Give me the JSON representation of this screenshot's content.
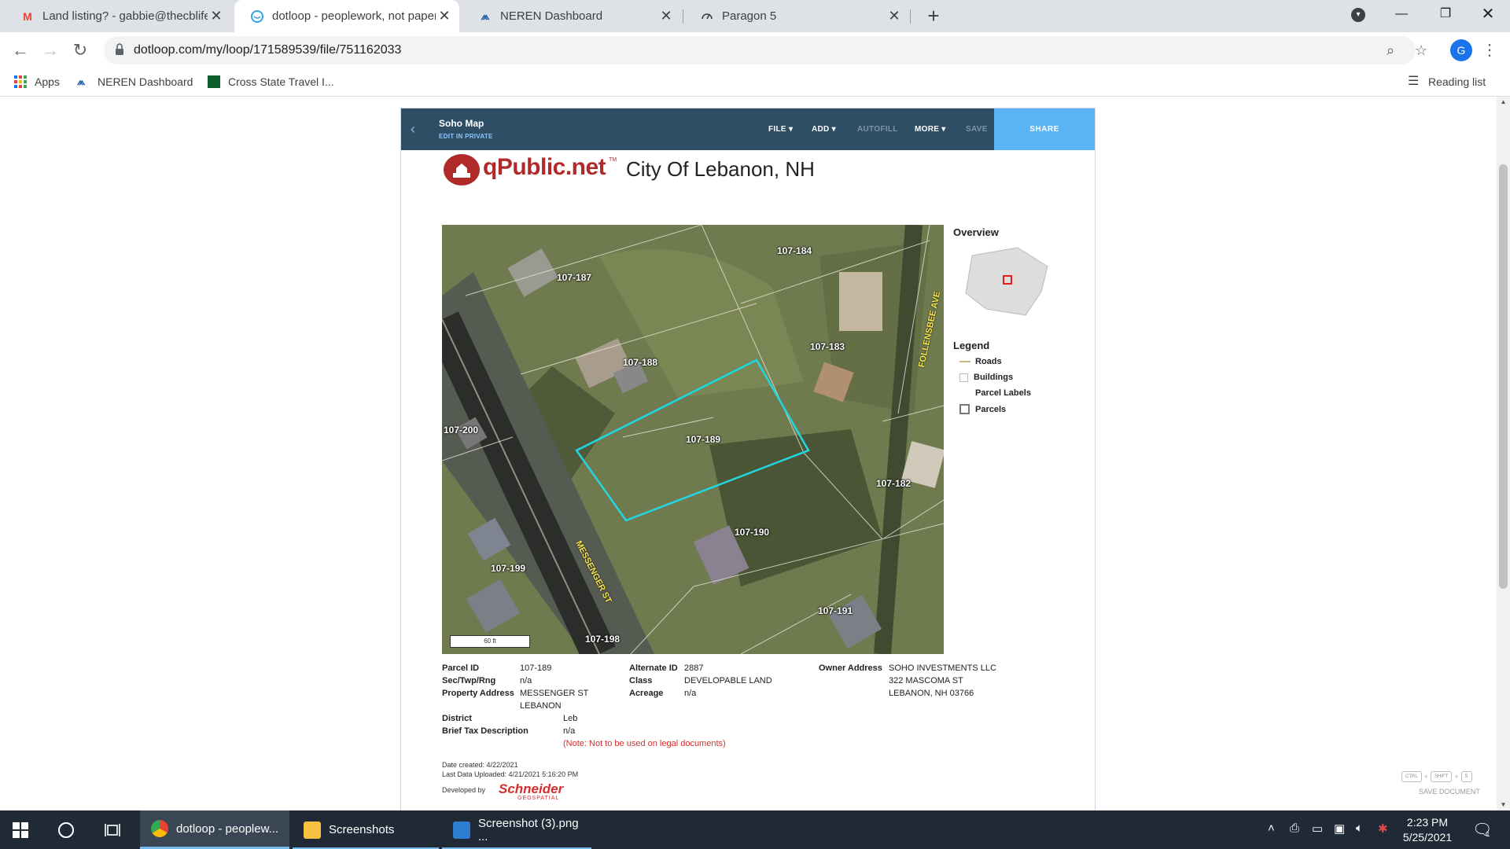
{
  "browser": {
    "tabs": [
      {
        "title": "Land listing? - gabbie@thecblife.",
        "icon": "gmail-icon",
        "active": false
      },
      {
        "title": "dotloop - peoplework, not paper.",
        "icon": "dotloop-icon",
        "active": true
      },
      {
        "title": "NEREN Dashboard",
        "icon": "neren-icon",
        "active": false
      },
      {
        "title": "Paragon 5",
        "icon": "paragon-icon",
        "active": false
      }
    ],
    "url": "dotloop.com/my/loop/171589539/file/751162033",
    "avatar_letter": "G",
    "bookmarks": [
      {
        "label": "Apps"
      },
      {
        "label": "NEREN Dashboard"
      },
      {
        "label": "Cross State Travel I..."
      }
    ],
    "reading_list": "Reading list"
  },
  "dotloop": {
    "doc_name": "Soho Map",
    "edit_mode": "EDIT IN PRIVATE",
    "menu": {
      "file": "FILE",
      "add": "ADD",
      "autofill": "AUTOFILL",
      "more": "MORE",
      "save": "SAVE",
      "share": "SHARE"
    },
    "save_shortcut": {
      "keys": [
        "CTRL",
        "SHIFT",
        "S"
      ],
      "label": "SAVE DOCUMENT"
    }
  },
  "document": {
    "logo_text": "qPublic.net",
    "logo_tm": "TM",
    "city": "City Of Lebanon, NH",
    "map": {
      "parcel_labels": [
        "107-187",
        "107-184",
        "107-183",
        "107-188",
        "107-200",
        "107-189",
        "107-182",
        "107-190",
        "107-199",
        "107-191",
        "107-198"
      ],
      "streets": [
        "MESSENGER ST",
        "FOLLENSBEE AVE"
      ],
      "scale": "60 ft"
    },
    "overview_title": "Overview",
    "legend_title": "Legend",
    "legend_items": [
      "Roads",
      "Buildings",
      "Parcel Labels",
      "Parcels"
    ],
    "fields": {
      "parcel_id_label": "Parcel ID",
      "parcel_id": "107-189",
      "sec_label": "Sec/Twp/Rng",
      "sec": "n/a",
      "address_label": "Property Address",
      "address_1": "MESSENGER ST",
      "address_2": "LEBANON",
      "district_label": "District",
      "district": "Leb",
      "brief_label": "Brief Tax Description",
      "brief": "n/a",
      "note": "(Note: Not to be used on legal documents)",
      "alt_id_label": "Alternate ID",
      "alt_id": "2887",
      "class_label": "Class",
      "class": "DEVELOPABLE LAND",
      "acreage_label": "Acreage",
      "acreage": "n/a",
      "owner_label": "Owner Address",
      "owner_1": "SOHO INVESTMENTS LLC",
      "owner_2": "322 MASCOMA ST",
      "owner_3": "LEBANON, NH 03766"
    },
    "date_created": "Date created: 4/22/2021",
    "last_upload": "Last Data Uploaded: 4/21/2021 5:16:20 PM",
    "developed_by": "Developed by",
    "developer": "Schneider",
    "developer_sub": "GEOSPATIAL"
  },
  "taskbar": {
    "apps": [
      {
        "label": "dotloop - peoplew...",
        "active": true
      },
      {
        "label": "Screenshots",
        "active": false
      },
      {
        "label": "Screenshot (3).png ...",
        "active": false
      }
    ],
    "time": "2:23 PM",
    "date": "5/25/2021",
    "notif_count": "1"
  }
}
